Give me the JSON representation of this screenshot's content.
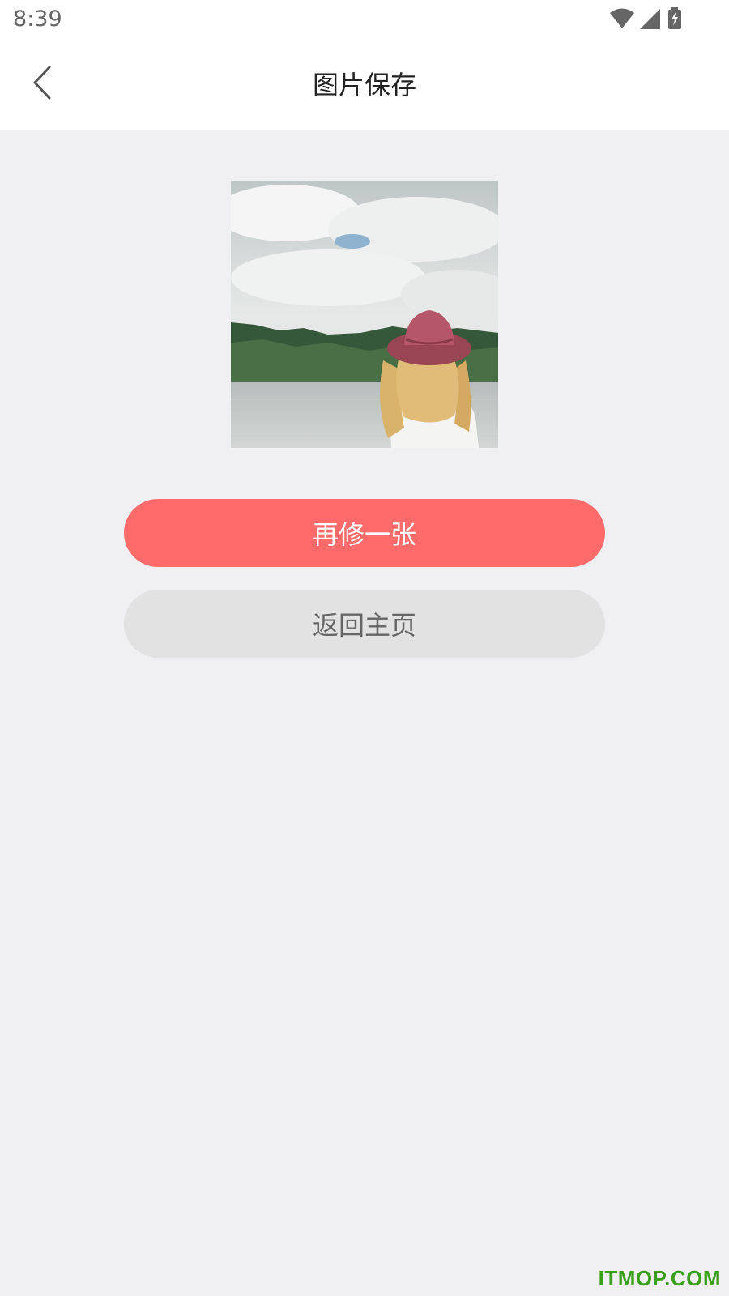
{
  "status_bar": {
    "time": "8:39",
    "icons": [
      "wifi-icon",
      "signal-icon",
      "battery-charging-icon"
    ]
  },
  "header": {
    "title": "图片保存",
    "back_icon": "chevron-left-icon"
  },
  "preview": {
    "image": "saved-photo"
  },
  "actions": {
    "primary_label": "再修一张",
    "secondary_label": "返回主页"
  },
  "watermark": "ITMOP.COM",
  "colors": {
    "accent": "#ff6b6b",
    "secondary_bg": "#e2e2e2",
    "page_bg": "#f0f0f3",
    "watermark": "#3aa01b"
  }
}
